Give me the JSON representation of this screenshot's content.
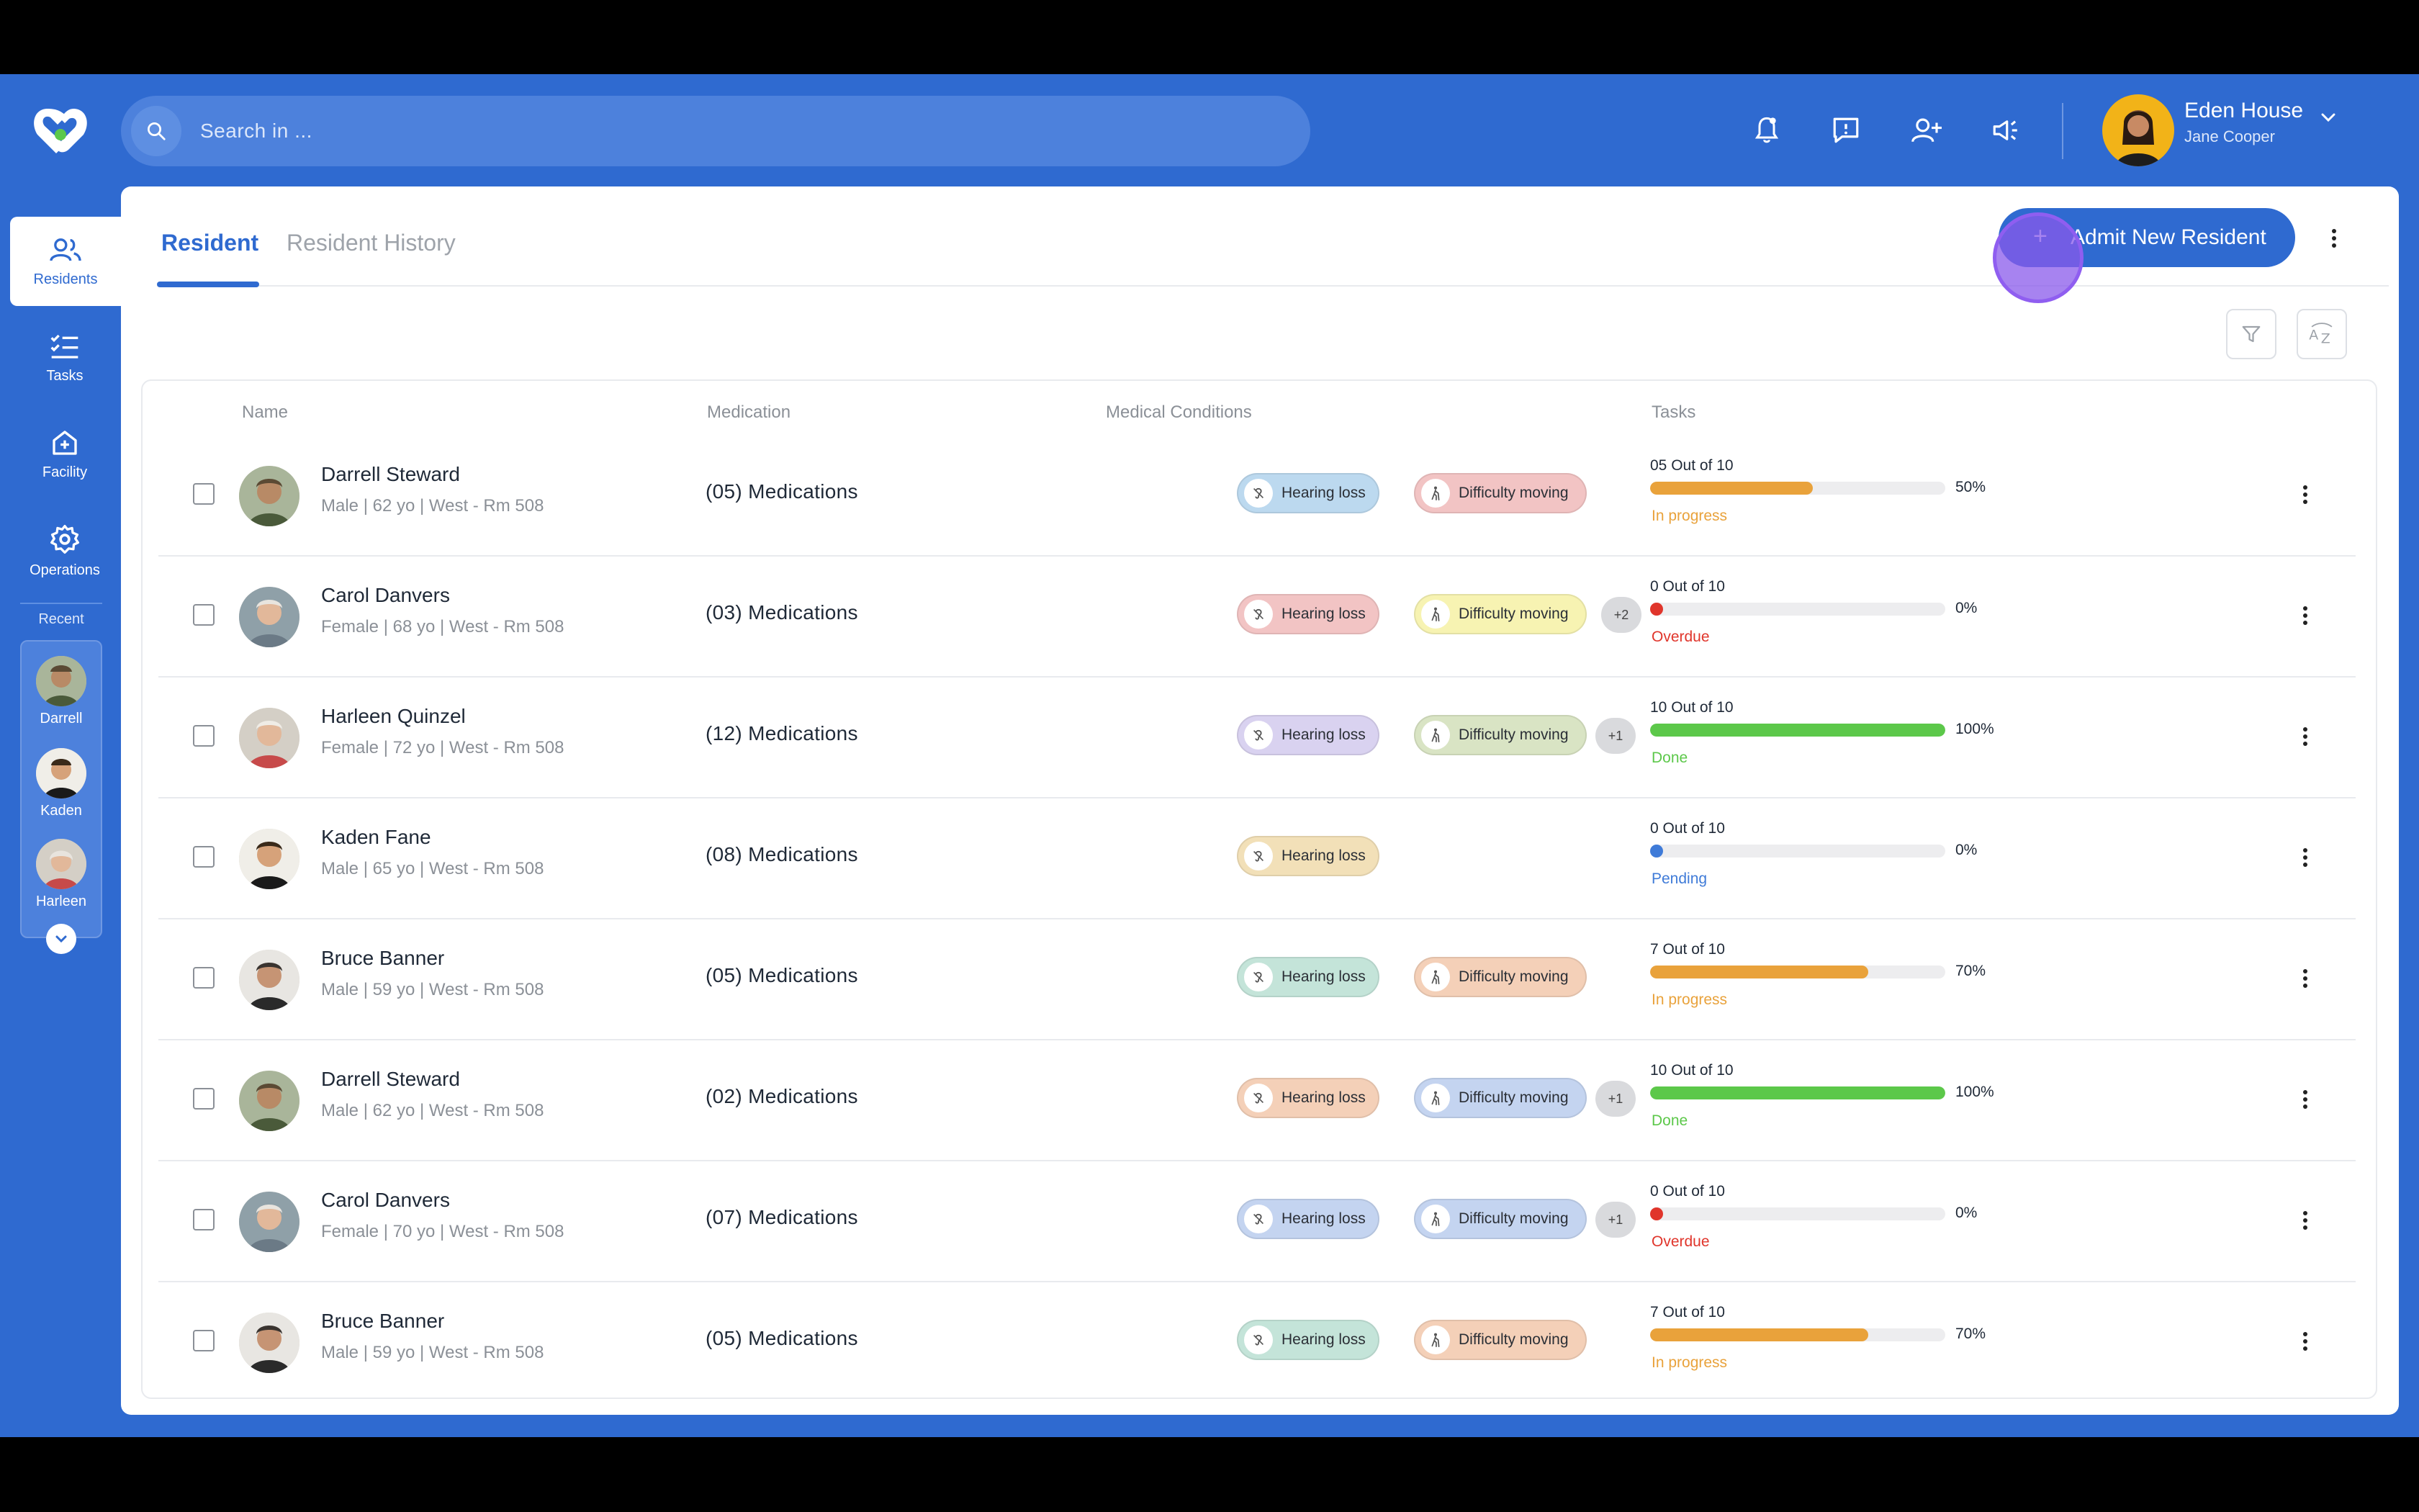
{
  "search": {
    "placeholder": "Search in ..."
  },
  "user": {
    "facility": "Eden House",
    "name": "Jane Cooper"
  },
  "sidebar": {
    "items": [
      {
        "label": "Residents",
        "icon": "users-icon"
      },
      {
        "label": "Tasks",
        "icon": "checklist-icon"
      },
      {
        "label": "Facility",
        "icon": "facility-icon"
      },
      {
        "label": "Operations",
        "icon": "gear-icon"
      }
    ],
    "recent_label": "Recent",
    "recent": [
      "Darrell",
      "Kaden",
      "Harleen"
    ]
  },
  "tabs": {
    "resident": "Resident",
    "history": "Resident History"
  },
  "admit_button": "Admit New Resident",
  "columns": {
    "name": "Name",
    "medication": "Medication",
    "conditions": "Medical Conditions",
    "tasks": "Tasks"
  },
  "colors": {
    "primary": "#2f6ad0",
    "in_progress": "#e9a23b",
    "overdue": "#e0352b",
    "done": "#5cc84a",
    "pending": "#3f7bd8"
  },
  "residents": [
    {
      "name": "Darrell Steward",
      "info": "Male | 62 yo | West - Rm 508",
      "medication": "(05) Medications",
      "conditions": [
        {
          "label": "Hearing loss",
          "color": "#bcd9ef"
        },
        {
          "label": "Difficulty moving",
          "color": "#f2c4c4"
        }
      ],
      "more": "",
      "tasks": "05 Out of 10",
      "progress": 55,
      "pct": "50%",
      "status": "In progress",
      "status_color": "#e9a23b"
    },
    {
      "name": "Carol Danvers",
      "info": "Female | 68 yo | West - Rm 508",
      "medication": "(03) Medications",
      "conditions": [
        {
          "label": "Hearing loss",
          "color": "#f2c4c4"
        },
        {
          "label": "Difficulty moving",
          "color": "#f7f3b2"
        }
      ],
      "more": "+2",
      "tasks": "0 Out of 10",
      "progress": 0,
      "pct": "0%",
      "status": "Overdue",
      "status_color": "#e0352b"
    },
    {
      "name": "Harleen Quinzel",
      "info": "Female | 72 yo | West - Rm 508",
      "medication": "(12) Medications",
      "conditions": [
        {
          "label": "Hearing loss",
          "color": "#d9d2f0"
        },
        {
          "label": "Difficulty moving",
          "color": "#d9e4c4"
        }
      ],
      "more": "+1",
      "tasks": "10 Out of 10",
      "progress": 100,
      "pct": "100%",
      "status": "Done",
      "status_color": "#5cc84a"
    },
    {
      "name": "Kaden Fane",
      "info": "Male | 65 yo | West - Rm 508",
      "medication": "(08) Medications",
      "conditions": [
        {
          "label": "Hearing loss",
          "color": "#f2e0b8"
        }
      ],
      "more": "",
      "tasks": "0 Out of 10",
      "progress": 0,
      "pct": "0%",
      "status": "Pending",
      "status_color": "#3f7bd8"
    },
    {
      "name": "Bruce Banner",
      "info": "Male | 59 yo | West - Rm 508",
      "medication": "(05) Medications",
      "conditions": [
        {
          "label": "Hearing loss",
          "color": "#c4e4d9"
        },
        {
          "label": "Difficulty moving",
          "color": "#f4d0b8"
        }
      ],
      "more": "",
      "tasks": "7 Out of 10",
      "progress": 74,
      "pct": "70%",
      "status": "In progress",
      "status_color": "#e9a23b"
    },
    {
      "name": "Darrell Steward",
      "info": "Male | 62 yo | West - Rm 508",
      "medication": "(02) Medications",
      "conditions": [
        {
          "label": "Hearing loss",
          "color": "#f4d0b8"
        },
        {
          "label": "Difficulty moving",
          "color": "#c4d4f0"
        }
      ],
      "more": "+1",
      "tasks": "10 Out of 10",
      "progress": 100,
      "pct": "100%",
      "status": "Done",
      "status_color": "#5cc84a"
    },
    {
      "name": "Carol Danvers",
      "info": "Female | 70 yo | West - Rm 508",
      "medication": "(07) Medications",
      "conditions": [
        {
          "label": "Hearing loss",
          "color": "#c4d4f0"
        },
        {
          "label": "Difficulty moving",
          "color": "#c4d4f0"
        }
      ],
      "more": "+1",
      "tasks": "0 Out of 10",
      "progress": 0,
      "pct": "0%",
      "status": "Overdue",
      "status_color": "#e0352b"
    },
    {
      "name": "Bruce Banner",
      "info": "Male | 59 yo | West - Rm 508",
      "medication": "(05) Medications",
      "conditions": [
        {
          "label": "Hearing loss",
          "color": "#c4e4d9"
        },
        {
          "label": "Difficulty moving",
          "color": "#f4d0b8"
        }
      ],
      "more": "",
      "tasks": "7 Out of 10",
      "progress": 74,
      "pct": "70%",
      "status": "In progress",
      "status_color": "#e9a23b"
    }
  ]
}
